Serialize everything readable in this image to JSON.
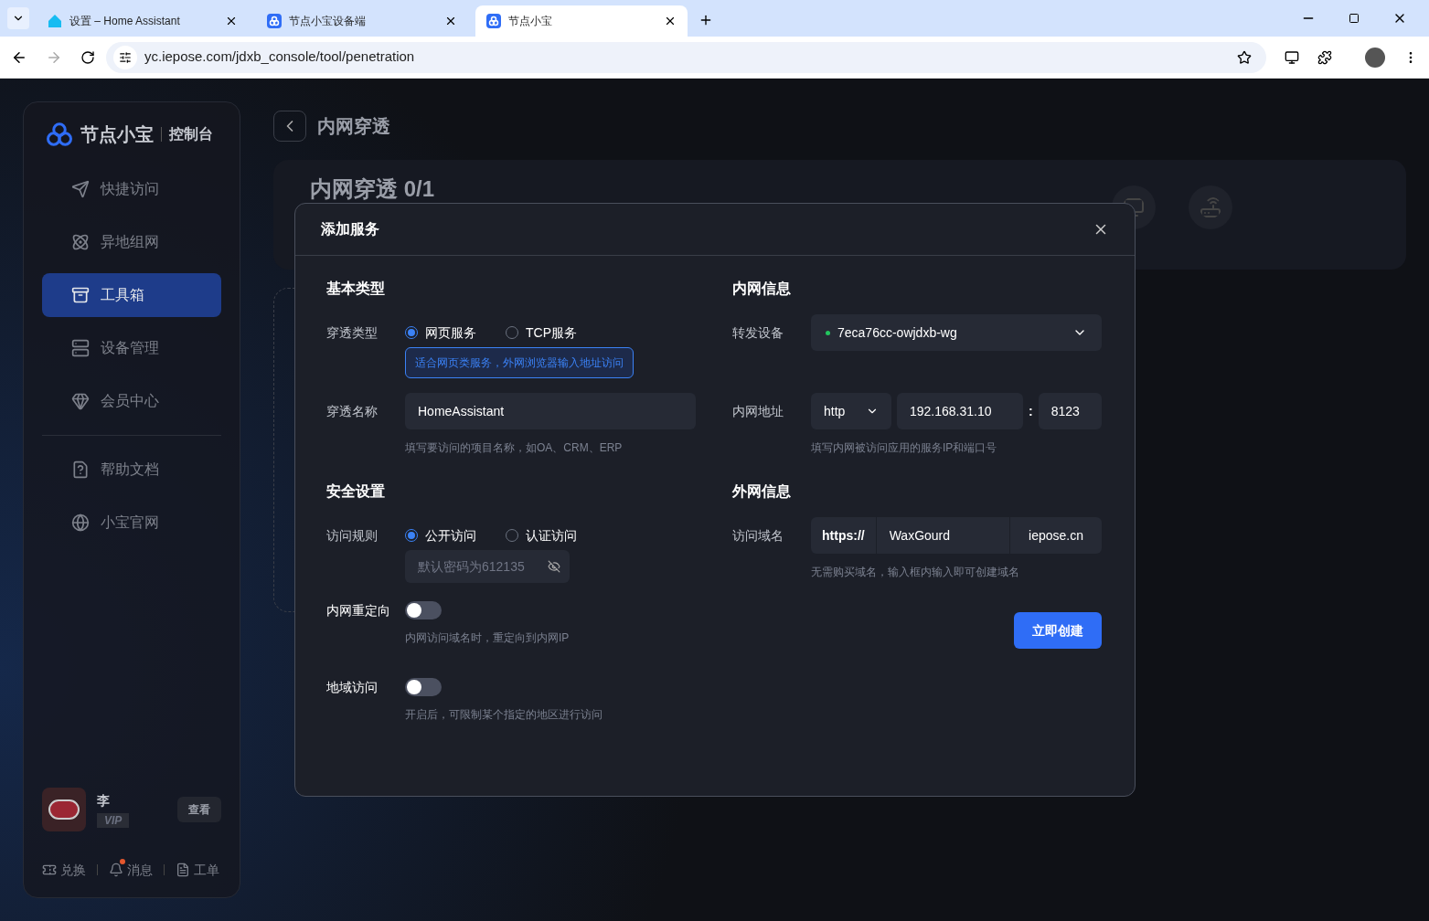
{
  "browser": {
    "tabs": [
      {
        "title": "设置 – Home Assistant",
        "selected": false,
        "kind": "ha"
      },
      {
        "title": "节点小宝设备端",
        "selected": false,
        "kind": "app"
      },
      {
        "title": "节点小宝",
        "selected": true,
        "kind": "app"
      }
    ],
    "url": "yc.iepose.com/jdxb_console/tool/penetration"
  },
  "sidebar": {
    "brand": "节点小宝",
    "brand_sub": "控制台",
    "items": [
      {
        "label": "快捷访问",
        "selected": false
      },
      {
        "label": "异地组网",
        "selected": false
      },
      {
        "label": "工具箱",
        "selected": true
      },
      {
        "label": "设备管理",
        "selected": false
      },
      {
        "label": "会员中心",
        "selected": false
      },
      {
        "label": "帮助文档",
        "selected": false
      },
      {
        "label": "小宝官网",
        "selected": false
      }
    ],
    "user": {
      "name": "李",
      "badge": "VIP",
      "view_button": "查看"
    },
    "footer": [
      {
        "label": "兑换",
        "notify": false
      },
      {
        "label": "消息",
        "notify": true
      },
      {
        "label": "工单",
        "notify": false
      }
    ]
  },
  "page": {
    "title": "内网穿透",
    "banner_title": "内网穿透 0/1"
  },
  "dialog": {
    "title": "添加服务",
    "basic": {
      "heading": "基本类型",
      "type_label": "穿透类型",
      "types": [
        {
          "label": "网页服务",
          "selected": true
        },
        {
          "label": "TCP服务",
          "selected": false
        }
      ],
      "type_hint": "适合网页类服务，外网浏览器输入地址访问",
      "name_label": "穿透名称",
      "name_value": "HomeAssistant",
      "name_help": "填写要访问的项目名称，如OA、CRM、ERP"
    },
    "security": {
      "heading": "安全设置",
      "rule_label": "访问规则",
      "rules": [
        {
          "label": "公开访问",
          "selected": true
        },
        {
          "label": "认证访问",
          "selected": false
        }
      ],
      "password_placeholder": "默认密码为612135",
      "password_disabled": true,
      "toggles": [
        {
          "label": "内网重定向",
          "on": false,
          "help": "内网访问域名时，重定向到内网IP"
        },
        {
          "label": "地域访问",
          "on": false,
          "help": "开启后，可限制某个指定的地区进行访问"
        }
      ]
    },
    "internal": {
      "heading": "内网信息",
      "device_label": "转发设备",
      "device_value": "7eca76cc-owjdxb-wg",
      "device_online": true,
      "addr_label": "内网地址",
      "protocol": "http",
      "ip": "192.168.31.10",
      "port_sep": ":",
      "port": "8123",
      "addr_help": "填写内网被访问应用的服务IP和端口号"
    },
    "external": {
      "heading": "外网信息",
      "domain_label": "访问域名",
      "scheme": "https://",
      "subdomain": "WaxGourd",
      "suffix": "iepose.cn",
      "domain_help": "无需购买域名，输入框内输入即可创建域名"
    },
    "submit": "立即创建"
  }
}
